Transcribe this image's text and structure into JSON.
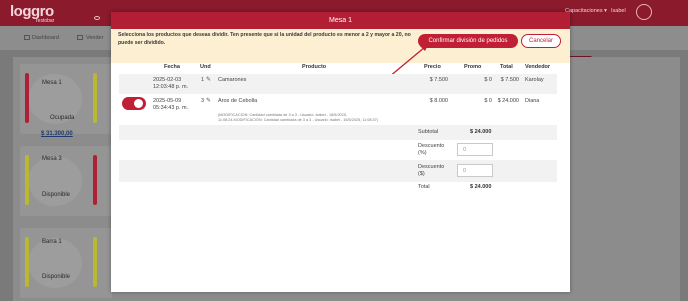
{
  "app": {
    "logo_text": "loggro",
    "logo_sub": "restobar",
    "user_menu": "Capacitaciones",
    "user_name": "Isabel",
    "nav": [
      {
        "label": "Dashboard"
      },
      {
        "label": "Vender"
      }
    ],
    "right_button_fragment": "na",
    "tables": [
      {
        "name": "Mesa 1",
        "state": "Ocupada",
        "amount": "$ 31.300,00",
        "bar_color": "#b02034"
      },
      {
        "name": "Mesa 3",
        "state": "Disponible",
        "bar_color": "#b8b832"
      },
      {
        "name": "Barra 1",
        "state": "Disponible",
        "bar_color": "#b8b832"
      }
    ]
  },
  "modal": {
    "title": "Mesa 1",
    "notice": "Selecciona los productos que deseas dividir. Ten presente que si la unidad del producto es menor a 2 y mayor a 20, no puede ser dividido.",
    "confirm_label": "Confirmar división de pedidos",
    "cancel_label": "Cancelar",
    "columns": [
      "Fecha",
      "Und",
      "Producto",
      "Precio",
      "Promo",
      "Total",
      "Vendedor"
    ],
    "rows": [
      {
        "date": "2025-02-03",
        "time": "12:03:48 p. m.",
        "qty": "1",
        "product": "Camarones",
        "price": "$ 7.500",
        "promo": "$ 0",
        "total": "$ 7.500",
        "seller": "Karolay",
        "selected": false
      },
      {
        "date": "2025-05-09",
        "time": "05:34:43 p. m.",
        "qty": "3",
        "product": "Aros de Cebolla",
        "price": "$ 8.000",
        "promo": "$ 0",
        "total": "$ 24.000",
        "seller": "Diana",
        "selected": true,
        "note_1": "(MODIFICACION: Cantidad cambiada de 3 a 3 - Usuario: Isabel - 16/5/2025,",
        "note_2": "11:08:24.MODIFICACION: Cantidad cambiada de 3 a 3 - Usuario: Isabel - 16/5/2025, 11:08:37)"
      }
    ],
    "summary": {
      "subtotal_label": "Subtotal",
      "subtotal_value": "$ 24.000",
      "discount_pct_label_1": "Descuento",
      "discount_pct_label_2": "(%)",
      "discount_pct_value": "0",
      "discount_amt_label_1": "Descuento",
      "discount_amt_label_2": "($)",
      "discount_amt_value": "0",
      "total_label": "Total",
      "total_value": "$ 24.000"
    }
  },
  "colors": {
    "brand": "#b21e34",
    "accent_button": "#c11f35",
    "notice_bg": "#fcefd2"
  }
}
